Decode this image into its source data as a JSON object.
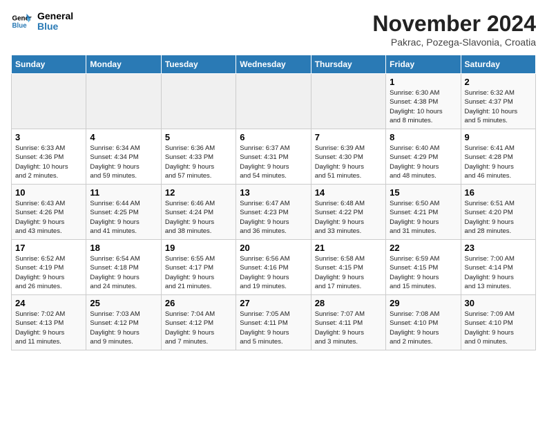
{
  "header": {
    "logo_line1": "General",
    "logo_line2": "Blue",
    "month_title": "November 2024",
    "location": "Pakrac, Pozega-Slavonia, Croatia"
  },
  "weekdays": [
    "Sunday",
    "Monday",
    "Tuesday",
    "Wednesday",
    "Thursday",
    "Friday",
    "Saturday"
  ],
  "weeks": [
    [
      {
        "day": "",
        "info": ""
      },
      {
        "day": "",
        "info": ""
      },
      {
        "day": "",
        "info": ""
      },
      {
        "day": "",
        "info": ""
      },
      {
        "day": "",
        "info": ""
      },
      {
        "day": "1",
        "info": "Sunrise: 6:30 AM\nSunset: 4:38 PM\nDaylight: 10 hours\nand 8 minutes."
      },
      {
        "day": "2",
        "info": "Sunrise: 6:32 AM\nSunset: 4:37 PM\nDaylight: 10 hours\nand 5 minutes."
      }
    ],
    [
      {
        "day": "3",
        "info": "Sunrise: 6:33 AM\nSunset: 4:36 PM\nDaylight: 10 hours\nand 2 minutes."
      },
      {
        "day": "4",
        "info": "Sunrise: 6:34 AM\nSunset: 4:34 PM\nDaylight: 9 hours\nand 59 minutes."
      },
      {
        "day": "5",
        "info": "Sunrise: 6:36 AM\nSunset: 4:33 PM\nDaylight: 9 hours\nand 57 minutes."
      },
      {
        "day": "6",
        "info": "Sunrise: 6:37 AM\nSunset: 4:31 PM\nDaylight: 9 hours\nand 54 minutes."
      },
      {
        "day": "7",
        "info": "Sunrise: 6:39 AM\nSunset: 4:30 PM\nDaylight: 9 hours\nand 51 minutes."
      },
      {
        "day": "8",
        "info": "Sunrise: 6:40 AM\nSunset: 4:29 PM\nDaylight: 9 hours\nand 48 minutes."
      },
      {
        "day": "9",
        "info": "Sunrise: 6:41 AM\nSunset: 4:28 PM\nDaylight: 9 hours\nand 46 minutes."
      }
    ],
    [
      {
        "day": "10",
        "info": "Sunrise: 6:43 AM\nSunset: 4:26 PM\nDaylight: 9 hours\nand 43 minutes."
      },
      {
        "day": "11",
        "info": "Sunrise: 6:44 AM\nSunset: 4:25 PM\nDaylight: 9 hours\nand 41 minutes."
      },
      {
        "day": "12",
        "info": "Sunrise: 6:46 AM\nSunset: 4:24 PM\nDaylight: 9 hours\nand 38 minutes."
      },
      {
        "day": "13",
        "info": "Sunrise: 6:47 AM\nSunset: 4:23 PM\nDaylight: 9 hours\nand 36 minutes."
      },
      {
        "day": "14",
        "info": "Sunrise: 6:48 AM\nSunset: 4:22 PM\nDaylight: 9 hours\nand 33 minutes."
      },
      {
        "day": "15",
        "info": "Sunrise: 6:50 AM\nSunset: 4:21 PM\nDaylight: 9 hours\nand 31 minutes."
      },
      {
        "day": "16",
        "info": "Sunrise: 6:51 AM\nSunset: 4:20 PM\nDaylight: 9 hours\nand 28 minutes."
      }
    ],
    [
      {
        "day": "17",
        "info": "Sunrise: 6:52 AM\nSunset: 4:19 PM\nDaylight: 9 hours\nand 26 minutes."
      },
      {
        "day": "18",
        "info": "Sunrise: 6:54 AM\nSunset: 4:18 PM\nDaylight: 9 hours\nand 24 minutes."
      },
      {
        "day": "19",
        "info": "Sunrise: 6:55 AM\nSunset: 4:17 PM\nDaylight: 9 hours\nand 21 minutes."
      },
      {
        "day": "20",
        "info": "Sunrise: 6:56 AM\nSunset: 4:16 PM\nDaylight: 9 hours\nand 19 minutes."
      },
      {
        "day": "21",
        "info": "Sunrise: 6:58 AM\nSunset: 4:15 PM\nDaylight: 9 hours\nand 17 minutes."
      },
      {
        "day": "22",
        "info": "Sunrise: 6:59 AM\nSunset: 4:15 PM\nDaylight: 9 hours\nand 15 minutes."
      },
      {
        "day": "23",
        "info": "Sunrise: 7:00 AM\nSunset: 4:14 PM\nDaylight: 9 hours\nand 13 minutes."
      }
    ],
    [
      {
        "day": "24",
        "info": "Sunrise: 7:02 AM\nSunset: 4:13 PM\nDaylight: 9 hours\nand 11 minutes."
      },
      {
        "day": "25",
        "info": "Sunrise: 7:03 AM\nSunset: 4:12 PM\nDaylight: 9 hours\nand 9 minutes."
      },
      {
        "day": "26",
        "info": "Sunrise: 7:04 AM\nSunset: 4:12 PM\nDaylight: 9 hours\nand 7 minutes."
      },
      {
        "day": "27",
        "info": "Sunrise: 7:05 AM\nSunset: 4:11 PM\nDaylight: 9 hours\nand 5 minutes."
      },
      {
        "day": "28",
        "info": "Sunrise: 7:07 AM\nSunset: 4:11 PM\nDaylight: 9 hours\nand 3 minutes."
      },
      {
        "day": "29",
        "info": "Sunrise: 7:08 AM\nSunset: 4:10 PM\nDaylight: 9 hours\nand 2 minutes."
      },
      {
        "day": "30",
        "info": "Sunrise: 7:09 AM\nSunset: 4:10 PM\nDaylight: 9 hours\nand 0 minutes."
      }
    ]
  ]
}
